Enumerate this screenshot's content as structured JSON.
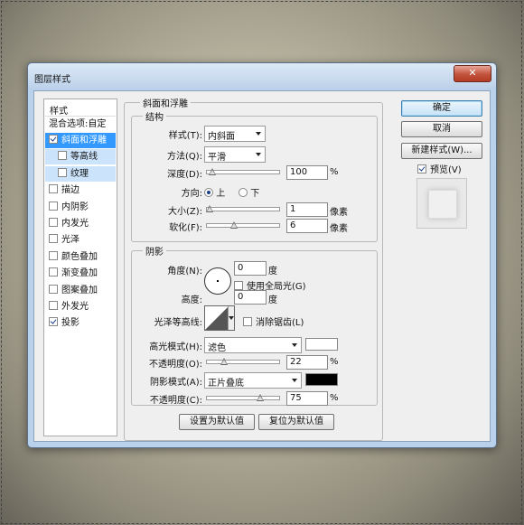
{
  "window": {
    "title": "图层样式",
    "close_symbol": "✕"
  },
  "style_list": {
    "header": "样式",
    "blend_options": "混合选项:自定",
    "items": [
      {
        "label": "斜面和浮雕",
        "checked": true,
        "selected": true
      },
      {
        "label": "等高线",
        "checked": false,
        "sub": true
      },
      {
        "label": "纹理",
        "checked": false,
        "sub": true
      },
      {
        "label": "描边",
        "checked": false
      },
      {
        "label": "内阴影",
        "checked": false
      },
      {
        "label": "内发光",
        "checked": false
      },
      {
        "label": "光泽",
        "checked": false
      },
      {
        "label": "颜色叠加",
        "checked": false
      },
      {
        "label": "渐变叠加",
        "checked": false
      },
      {
        "label": "图案叠加",
        "checked": false
      },
      {
        "label": "外发光",
        "checked": false
      },
      {
        "label": "投影",
        "checked": true
      }
    ]
  },
  "bevel": {
    "title": "斜面和浮雕",
    "structure_title": "结构",
    "style_label": "样式(T):",
    "style_value": "内斜面",
    "technique_label": "方法(Q):",
    "technique_value": "平滑",
    "depth_label": "深度(D):",
    "depth_value": "100",
    "depth_unit": "%",
    "direction_label": "方向:",
    "direction_up": "上",
    "direction_down": "下",
    "direction_selected": "up",
    "size_label": "大小(Z):",
    "size_value": "1",
    "size_unit": "像素",
    "soften_label": "软化(F):",
    "soften_value": "6",
    "soften_unit": "像素",
    "slider_levels": {
      "depth": 0.04,
      "size": 0.0,
      "soften": 0.36
    }
  },
  "shading": {
    "title": "阴影",
    "angle_label": "角度(N):",
    "angle_value": "0",
    "angle_unit": "度",
    "global_light_label": "使用全局光(G)",
    "altitude_label": "高度:",
    "altitude_value": "0",
    "altitude_unit": "度",
    "gloss_contour_label": "光泽等高线:",
    "anti_aliased_label": "消除锯齿(L)",
    "highlight_mode_label": "高光模式(H):",
    "highlight_mode_value": "滤色",
    "highlight_color": "#ffffff",
    "highlight_opacity_label": "不透明度(O):",
    "highlight_opacity_value": "22",
    "highlight_opacity_unit": "%",
    "shadow_mode_label": "阴影模式(A):",
    "shadow_mode_value": "正片叠底",
    "shadow_color": "#000000",
    "shadow_opacity_label": "不透明度(C):",
    "shadow_opacity_value": "75",
    "shadow_opacity_unit": "%",
    "slider_levels": {
      "highlight_opacity": 0.22,
      "shadow_opacity": 0.75
    }
  },
  "footer": {
    "make_default": "设置为默认值",
    "reset_default": "复位为默认值"
  },
  "right_panel": {
    "ok": "确定",
    "cancel": "取消",
    "new_style": "新建样式(W)...",
    "preview_label": "预览(V)"
  }
}
